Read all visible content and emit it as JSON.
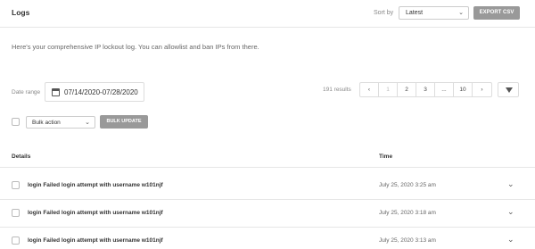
{
  "header": {
    "title": "Logs",
    "sort_label": "Sort by",
    "sort_value": "Latest",
    "export_label": "EXPORT CSV"
  },
  "intro": "Here's your comprehensive IP lockout log. You can allowlist and ban IPs from there.",
  "filters": {
    "range_label": "Date range",
    "range_value": "07/14/2020-07/28/2020",
    "results": "191 results",
    "pages": [
      "‹",
      "1",
      "2",
      "3",
      "...",
      "10",
      "›"
    ]
  },
  "bulk": {
    "select_value": "Bulk action",
    "button_label": "BULK UPDATE"
  },
  "table": {
    "headers": [
      "Details",
      "Time"
    ],
    "rows": [
      {
        "detail": "login Failed login attempt with username w101njf",
        "time": "July 25, 2020 3:25 am"
      },
      {
        "detail": "login Failed login attempt with username w101njf",
        "time": "July 25, 2020 3:18 am"
      },
      {
        "detail": "login Failed login attempt with username w101njf",
        "time": "July 25, 2020 3:13 am"
      }
    ]
  }
}
